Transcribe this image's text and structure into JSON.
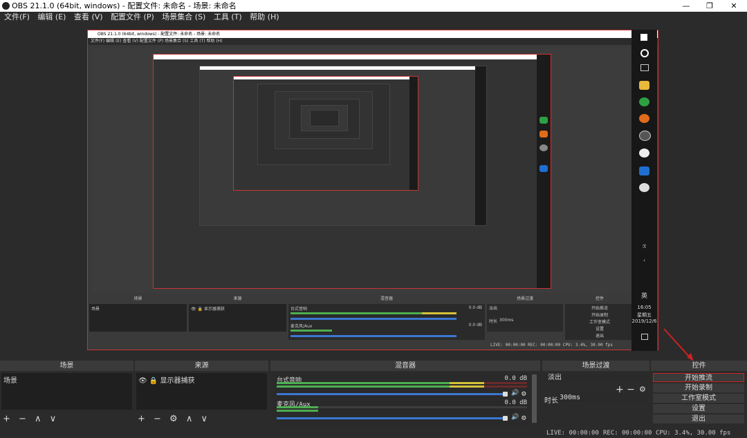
{
  "window": {
    "title": "OBS 21.1.0 (64bit, windows) - 配置文件: 未命名 - 场景: 未命名",
    "min": "—",
    "max": "❐",
    "close": "✕"
  },
  "menu": [
    "文件(F)",
    "编辑 (E)",
    "查看 (V)",
    "配置文件 (P)",
    "场景集合 (S)",
    "工具 (T)",
    "帮助 (H)"
  ],
  "nested": {
    "title": "OBS 21.1.0 (64bit, windows) - 配置文件: 未命名 - 场景: 未命名",
    "menu": "文件(F)  编辑 (E)  查看 (V)  配置文件 (P)  场景集合 (S)  工具 (T)  帮助 (H)",
    "dock_titles": [
      "场景",
      "来源",
      "混音器",
      "场景过渡",
      "控件"
    ],
    "scene": "场景",
    "source": "👁 🔒 显示器捕获",
    "mixer_1": "台式音响",
    "mixer_2": "麦克风/Aux",
    "db": "0.0 dB",
    "transition": "淡出",
    "duration_label": "时长",
    "duration": "300ms",
    "controls": [
      "开始推流",
      "开始录制",
      "工作室模式",
      "设置",
      "退出"
    ],
    "status": "LIVE: 00:00:00   REC: 00:00:00   CPU: 3.4%, 30.00 fps",
    "clock_time": "16:05",
    "clock_day": "星期五",
    "clock_date": "2019/12/6",
    "ime": "英"
  },
  "docks": {
    "scenes": {
      "title": "场景",
      "items": [
        "场景"
      ],
      "footer": "+ − ∧ ∨"
    },
    "sources": {
      "title": "来源",
      "items": [
        "显示器捕获"
      ],
      "footer": "+ − ⚙ ∧ ∨"
    },
    "mixer": {
      "title": "混音器",
      "channels": [
        {
          "name": "台式音响",
          "db": "0.0 dB"
        },
        {
          "name": "麦克风/Aux",
          "db": "0.0 dB"
        }
      ]
    },
    "transitions": {
      "title": "场景过渡",
      "selected": "淡出",
      "duration_label": "时长",
      "duration": "300ms",
      "add_remove": "+ −"
    },
    "controls": {
      "title": "控件",
      "buttons": [
        "开始推流",
        "开始录制",
        "工作室模式",
        "设置",
        "退出"
      ]
    }
  },
  "status": {
    "live": "LIVE: 00:00:00",
    "rec": "REC: 00:00:00",
    "cpu": "CPU: 3.4%, 30.00 fps"
  },
  "colors": {
    "accent_red": "#cc3333",
    "meter_green": "#4caf50",
    "meter_yellow": "#d4c23a",
    "meter_red": "#c0392b",
    "slider_blue": "#3b78d4"
  }
}
